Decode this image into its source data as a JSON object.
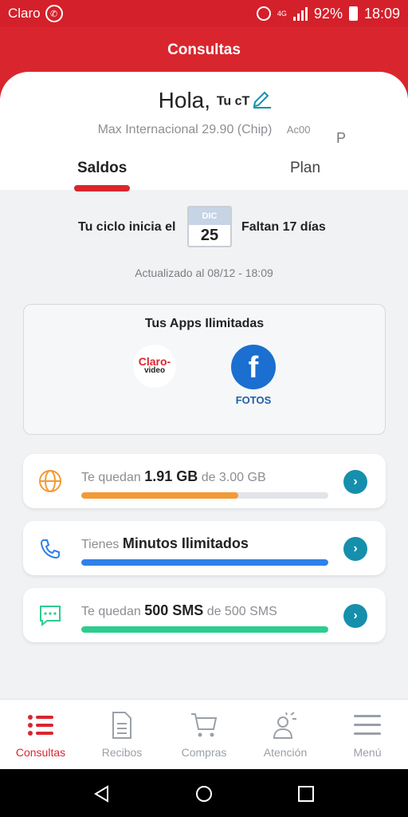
{
  "status_bar": {
    "carrier": "Claro",
    "network": "4G",
    "battery": "92%",
    "time": "18:09"
  },
  "header": {
    "title": "Consultas"
  },
  "profile": {
    "greeting": "Hola,",
    "name": "Tu cT",
    "plan": "Max Internacional 29.90 (Chip)",
    "plan_suffix": "Ac00",
    "plan_extra": "P"
  },
  "tabs": [
    {
      "label": "Saldos",
      "active": true
    },
    {
      "label": "Plan",
      "active": false
    }
  ],
  "cycle": {
    "left_text": "Tu ciclo inicia el",
    "month": "DIC",
    "day": "25",
    "right_text": "Faltan 17 días",
    "updated": "Actualizado al 08/12 - 18:09"
  },
  "apps": {
    "title": "Tus Apps Ilimitadas",
    "claro_video": {
      "line1": "Claro-",
      "line2": "video"
    },
    "facebook": {
      "glyph": "f",
      "label": "FOTOS"
    }
  },
  "balances": [
    {
      "prefix": "Te quedan",
      "value": "1.91 GB",
      "suffix": "de 3.00 GB",
      "progress": 0.637,
      "color": "#f39a36",
      "icon": "globe-icon"
    },
    {
      "prefix": "Tienes",
      "value": "Minutos Ilimitados",
      "suffix": "",
      "progress": 1.0,
      "color": "#2f80e8",
      "icon": "phone-icon"
    },
    {
      "prefix": "Te quedan",
      "value": "500 SMS",
      "suffix": "de 500 SMS",
      "progress": 1.0,
      "color": "#2dcc8f",
      "icon": "chat-icon"
    }
  ],
  "bottom_nav": [
    {
      "label": "Consultas",
      "icon": "list-icon",
      "active": true
    },
    {
      "label": "Recibos",
      "icon": "receipt-icon",
      "active": false
    },
    {
      "label": "Compras",
      "icon": "cart-icon",
      "active": false
    },
    {
      "label": "Atención",
      "icon": "agent-icon",
      "active": false
    },
    {
      "label": "Menú",
      "icon": "hamburger-icon",
      "active": false
    }
  ],
  "colors": {
    "brand_red": "#d9262e",
    "teal": "#168fac"
  }
}
